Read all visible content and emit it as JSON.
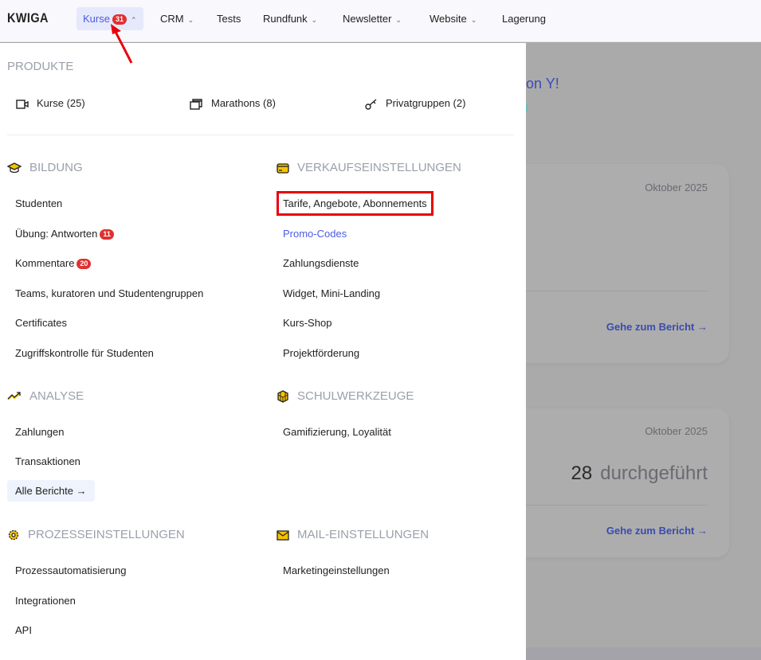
{
  "nav": {
    "logo": "KWIGA",
    "items": [
      {
        "label": "Kurse",
        "badge": "31",
        "chevron": "up",
        "active": true
      },
      {
        "label": "CRM",
        "chevron": "down"
      },
      {
        "label": "Tests"
      },
      {
        "label": "Rundfunk",
        "chevron": "down"
      },
      {
        "label": "Newsletter",
        "chevron": "down"
      },
      {
        "label": "Website",
        "chevron": "down"
      },
      {
        "label": "Lagerung"
      }
    ]
  },
  "background": {
    "title_fragment": "on Y!",
    "cards": [
      {
        "date": "Oktober 2025",
        "link": "Gehe zum Bericht →"
      },
      {
        "date": "Oktober 2025",
        "value": "28",
        "value_label": "durchgeführt",
        "link": "Gehe zum Bericht →"
      }
    ]
  },
  "menu": {
    "produkte": {
      "title": "PRODUKTE",
      "items": [
        {
          "label": "Kurse (25)",
          "icon": "video-icon"
        },
        {
          "label": "Marathons (8)",
          "icon": "stack-icon"
        },
        {
          "label": "Privatgruppen (2)",
          "icon": "key-icon"
        }
      ]
    },
    "bildung": {
      "title": "BILDUNG",
      "items": [
        {
          "label": "Studenten"
        },
        {
          "label": "Übung: Antworten",
          "badge": "11"
        },
        {
          "label": "Kommentare",
          "badge": "20"
        },
        {
          "label": "Teams, kuratoren und Studentengruppen"
        },
        {
          "label": "Certificates"
        },
        {
          "label": "Zugriffskontrolle für Studenten"
        }
      ]
    },
    "verkauf": {
      "title": "VERKAUFSEINSTELLUNGEN",
      "items": [
        {
          "label": "Tarife, Angebote, Abonnements",
          "highlighted": true
        },
        {
          "label": "Promo-Codes",
          "active": true
        },
        {
          "label": "Zahlungsdienste"
        },
        {
          "label": "Widget, Mini-Landing"
        },
        {
          "label": "Kurs-Shop"
        },
        {
          "label": "Projektförderung"
        }
      ]
    },
    "analyse": {
      "title": "ANALYSE",
      "items": [
        {
          "label": "Zahlungen"
        },
        {
          "label": "Transaktionen"
        }
      ],
      "all_reports": "Alle Berichte →"
    },
    "schul": {
      "title": "SCHULWERKZEUGE",
      "items": [
        {
          "label": "Gamifizierung, Loyalität"
        }
      ]
    },
    "prozess": {
      "title": "PROZESSEINSTELLUNGEN",
      "items": [
        {
          "label": "Prozessautomatisierung"
        },
        {
          "label": "Integrationen"
        },
        {
          "label": "API"
        }
      ]
    },
    "mail": {
      "title": "MAIL-EINSTELLUNGEN",
      "items": [
        {
          "label": "Marketingeinstellungen"
        }
      ]
    }
  },
  "colors": {
    "accent": "#4a5de8",
    "badge": "#e03131",
    "highlight": "#e8000b",
    "icon": "#f5c400"
  }
}
